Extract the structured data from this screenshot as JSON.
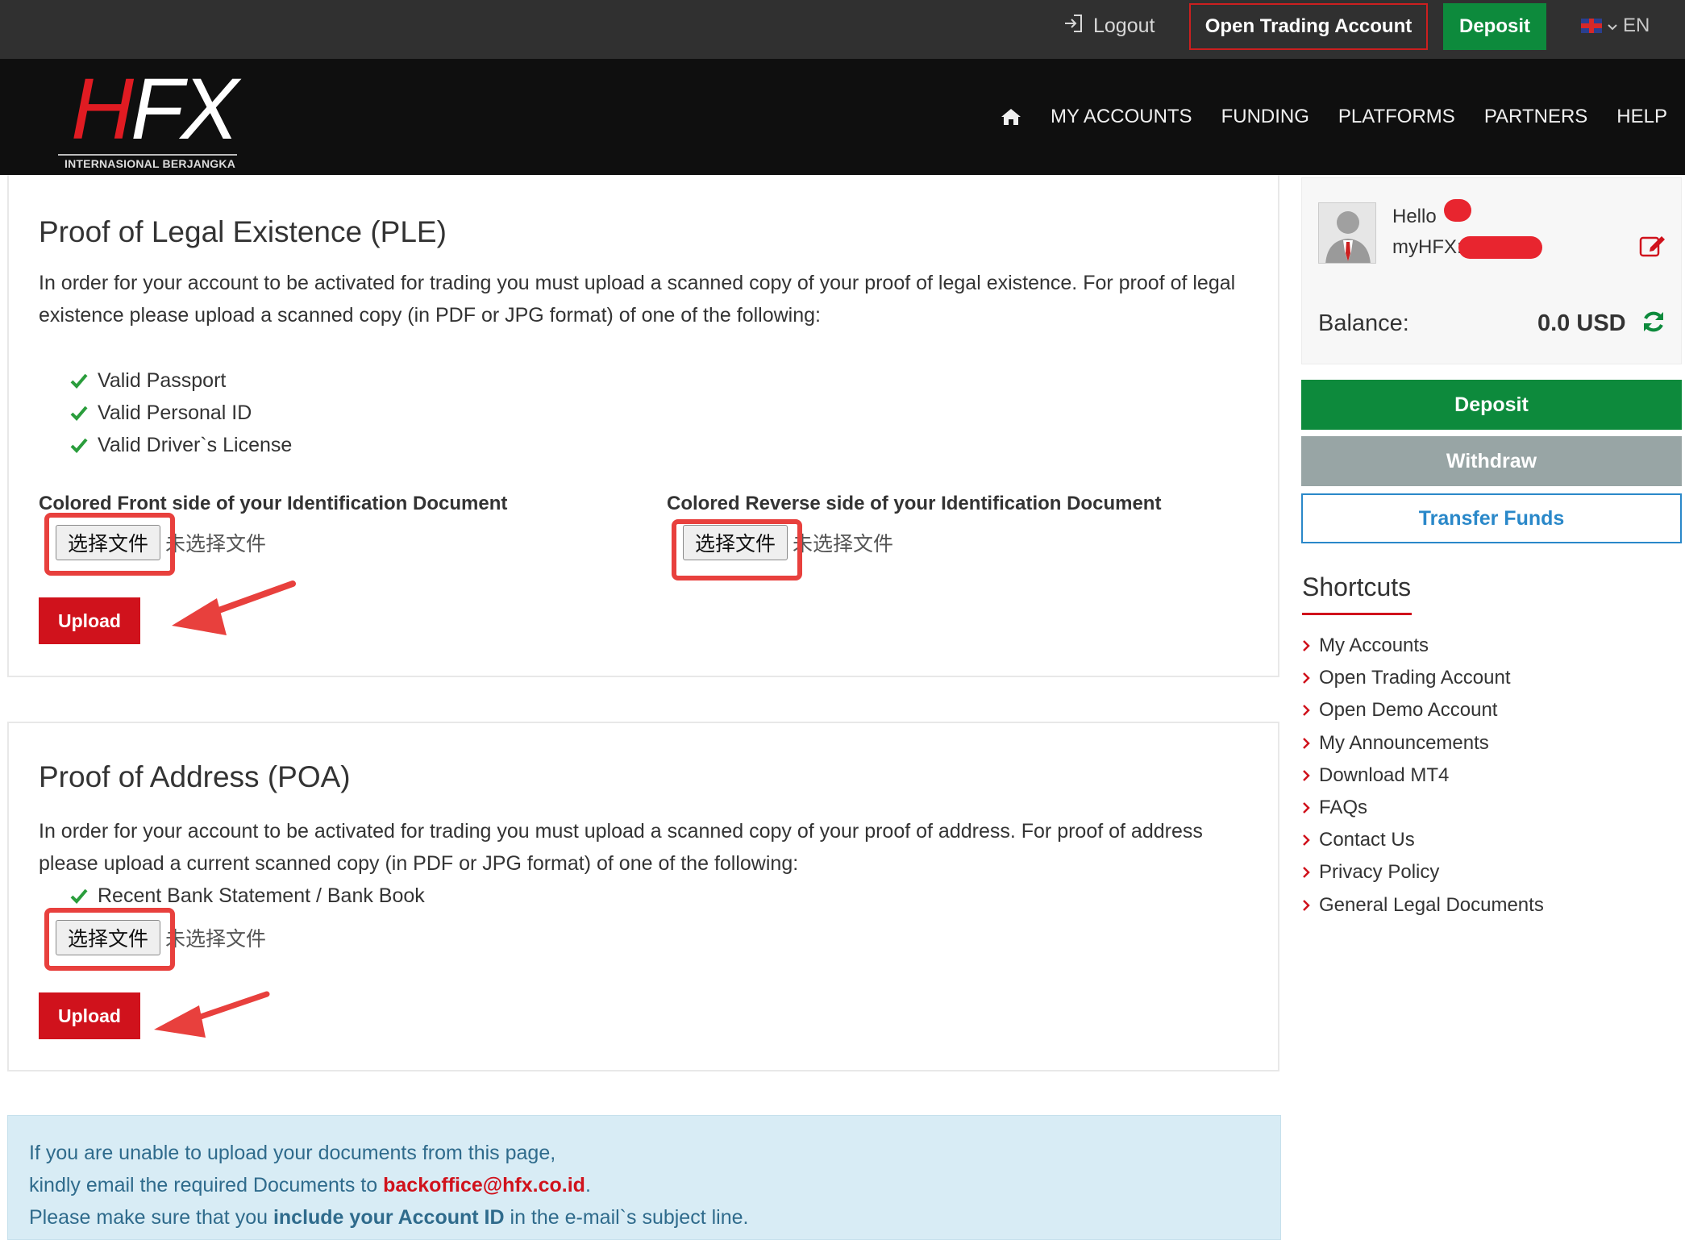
{
  "topbar": {
    "logout_label": "Logout",
    "open_account_label": "Open Trading Account",
    "deposit_label": "Deposit",
    "lang_label": "EN"
  },
  "header": {
    "logo_h": "H",
    "logo_fx": "FX",
    "logo_sub": "INTERNASIONAL BERJANGKA",
    "nav": [
      "MY ACCOUNTS",
      "FUNDING",
      "PLATFORMS",
      "PARTNERS",
      "HELP"
    ]
  },
  "ple": {
    "title": "Proof of Legal Existence (PLE)",
    "desc": "In order for your account to be activated for trading you must upload a scanned copy of your proof of legal existence. For proof of legal existence please upload a scanned copy (in PDF or JPG format) of one of the following:",
    "items": [
      "Valid Passport",
      "Valid Personal ID",
      "Valid Driver`s License"
    ],
    "front_label": "Colored Front side of your Identification Document",
    "reverse_label": "Colored Reverse side of your Identification Document",
    "choose_file": "选择文件",
    "no_file": "未选择文件",
    "upload": "Upload"
  },
  "poa": {
    "title": "Proof of Address (POA)",
    "desc": "In order for your account to be activated for trading you must upload a scanned copy of your proof of address. For proof of address please upload a current scanned copy (in PDF or JPG format) of one of the following:",
    "items": [
      "Recent Bank Statement / Bank Book"
    ],
    "choose_file": "选择文件",
    "no_file": "未选择文件",
    "upload": "Upload"
  },
  "info": {
    "line1": "If you are unable to upload your documents from this page,",
    "line2_pre": "kindly email the required Documents to ",
    "email": "backoffice@hfx.co.id",
    "line2_post": ".",
    "line3_pre": "Please make sure that you ",
    "line3_bold": "include your Account ID",
    "line3_post": " in the e-mail`s subject line."
  },
  "user": {
    "hello": "Hello",
    "myhfx": "myHFX:",
    "balance_label": "Balance:",
    "balance_value": "0.0 USD"
  },
  "sidebar": {
    "deposit": "Deposit",
    "withdraw": "Withdraw",
    "transfer": "Transfer Funds",
    "shortcuts_title": "Shortcuts",
    "shortcuts": [
      "My Accounts",
      "Open Trading Account",
      "Open Demo Account",
      "My Announcements",
      "Download MT4",
      "FAQs",
      "Contact Us",
      "Privacy Policy",
      "General Legal Documents"
    ]
  },
  "colors": {
    "brand_red": "#d0121c",
    "deposit_green": "#0d8a3c",
    "highlight_red": "#e8403d",
    "info_bg": "#d8ecf5"
  },
  "icons": [
    "logout-icon",
    "flag-icon",
    "home-icon",
    "check-icon",
    "edit-icon",
    "refresh-icon",
    "chevron-right-icon",
    "arrow-annotation"
  ]
}
